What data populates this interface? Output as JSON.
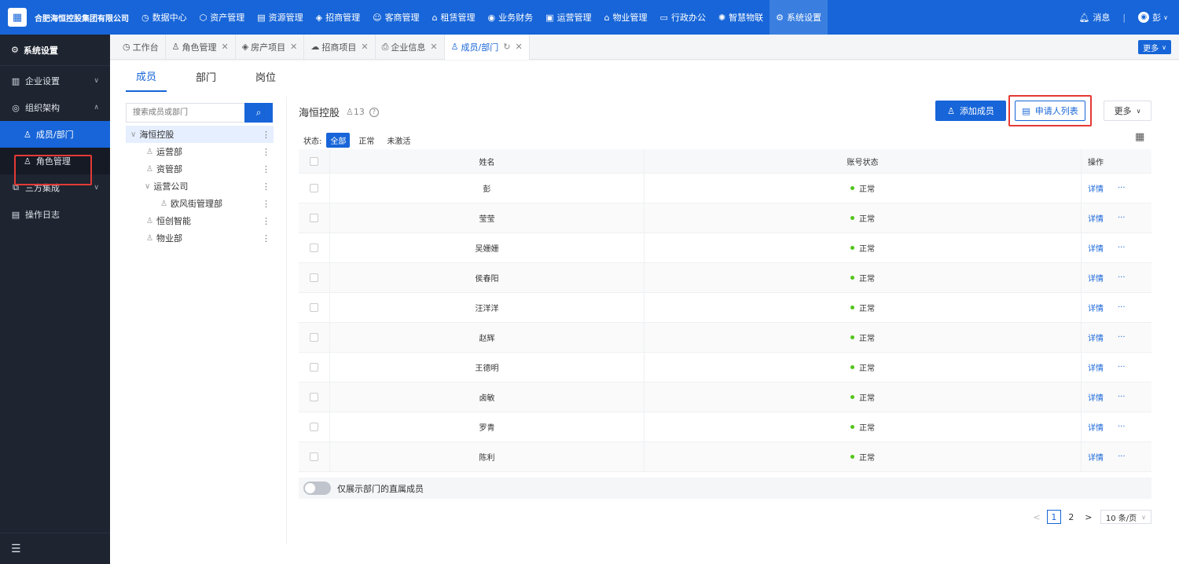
{
  "app": {
    "company": "合肥海恒控股集团有限公司"
  },
  "topnav": [
    {
      "icon": "◷",
      "label": "数据中心"
    },
    {
      "icon": "⬡",
      "label": "资产管理"
    },
    {
      "icon": "▤",
      "label": "资源管理"
    },
    {
      "icon": "◈",
      "label": "招商管理"
    },
    {
      "icon": "☺",
      "label": "客商管理"
    },
    {
      "icon": "⌂",
      "label": "租赁管理"
    },
    {
      "icon": "◉",
      "label": "业务财务"
    },
    {
      "icon": "▣",
      "label": "运营管理"
    },
    {
      "icon": "⌂",
      "label": "物业管理"
    },
    {
      "icon": "▭",
      "label": "行政办公"
    },
    {
      "icon": "✺",
      "label": "智慧物联"
    },
    {
      "icon": "⚙",
      "label": "系统设置"
    }
  ],
  "topright": {
    "messages": "消息",
    "user": "彭",
    "avatar": "◉"
  },
  "sidebar": {
    "title": "系统设置",
    "items": [
      {
        "label": "企业设置"
      },
      {
        "label": "组织架构"
      },
      {
        "label": "成员/部门"
      },
      {
        "label": "角色管理"
      },
      {
        "label": "三方集成"
      },
      {
        "label": "操作日志"
      }
    ]
  },
  "tabs": [
    {
      "label": "工作台"
    },
    {
      "label": "角色管理"
    },
    {
      "label": "房产项目"
    },
    {
      "label": "招商项目"
    },
    {
      "label": "企业信息"
    },
    {
      "label": "成员/部门"
    }
  ],
  "tabs_more": "更多",
  "subtabs": [
    "成员",
    "部门",
    "岗位"
  ],
  "search": {
    "placeholder": "搜索成员或部门"
  },
  "tree": [
    {
      "label": "海恒控股"
    },
    {
      "label": "运营部"
    },
    {
      "label": "资管部"
    },
    {
      "label": "运营公司"
    },
    {
      "label": "欧风街管理部"
    },
    {
      "label": "恒创智能"
    },
    {
      "label": "物业部"
    }
  ],
  "org": {
    "title": "海恒控股",
    "count": "13"
  },
  "buttons": {
    "add": "添加成员",
    "apply": "申请人列表",
    "more": "更多"
  },
  "status_filter": {
    "label": "状态:",
    "options": [
      "全部",
      "正常",
      "未激活"
    ]
  },
  "table": {
    "headers": {
      "name": "姓名",
      "status": "账号状态",
      "op": "操作"
    },
    "rows": [
      {
        "name": "彭",
        "status": "正常"
      },
      {
        "name": "莹莹",
        "status": "正常"
      },
      {
        "name": "吴姗姗",
        "status": "正常"
      },
      {
        "name": "侯春阳",
        "status": "正常"
      },
      {
        "name": "汪洋洋",
        "status": "正常"
      },
      {
        "name": "赵辉",
        "status": "正常"
      },
      {
        "name": "王德明",
        "status": "正常"
      },
      {
        "name": "卤敏",
        "status": "正常"
      },
      {
        "name": "罗青",
        "status": "正常"
      },
      {
        "name": "陈利",
        "status": "正常"
      }
    ],
    "detail": "详情",
    "ellipsis": "···"
  },
  "toggle": {
    "label": "仅展示部门的直属成员"
  },
  "pager": {
    "prev": "<",
    "pages": [
      "1",
      "2"
    ],
    "next": ">",
    "size": "10 条/页"
  }
}
